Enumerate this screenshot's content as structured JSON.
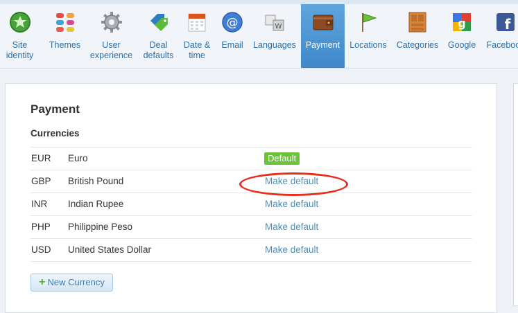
{
  "toolbar": {
    "tabs": [
      {
        "label": "Site\nidentity",
        "icon": "site-identity-icon"
      },
      {
        "label": "Themes",
        "icon": "themes-icon"
      },
      {
        "label": "User\nexperience",
        "icon": "gear-icon"
      },
      {
        "label": "Deal\ndefaults",
        "icon": "tags-icon"
      },
      {
        "label": "Date &\ntime",
        "icon": "calendar-icon"
      },
      {
        "label": "Email",
        "icon": "at-icon"
      },
      {
        "label": "Languages",
        "icon": "languages-icon"
      },
      {
        "label": "Payment",
        "icon": "wallet-icon",
        "active": true
      },
      {
        "label": "Locations",
        "icon": "flag-icon"
      },
      {
        "label": "Categories",
        "icon": "cabinet-icon"
      },
      {
        "label": "Google",
        "icon": "google-icon"
      },
      {
        "label": "Facebook",
        "icon": "facebook-icon"
      }
    ]
  },
  "panel": {
    "title": "Payment",
    "subtitle": "Currencies",
    "currencies": [
      {
        "code": "EUR",
        "name": "Euro",
        "action": "Default",
        "is_default": true
      },
      {
        "code": "GBP",
        "name": "British Pound",
        "action": "Make default",
        "is_default": false
      },
      {
        "code": "INR",
        "name": "Indian Rupee",
        "action": "Make default",
        "is_default": false
      },
      {
        "code": "PHP",
        "name": "Philippine Peso",
        "action": "Make default",
        "is_default": false
      },
      {
        "code": "USD",
        "name": "United States Dollar",
        "action": "Make default",
        "is_default": false
      }
    ],
    "new_button": "New Currency"
  },
  "colors": {
    "accent": "#4b8fb8",
    "active_tab": "#4a93d0",
    "default_badge": "#6cc23a",
    "highlight_circle": "#e5301b"
  }
}
